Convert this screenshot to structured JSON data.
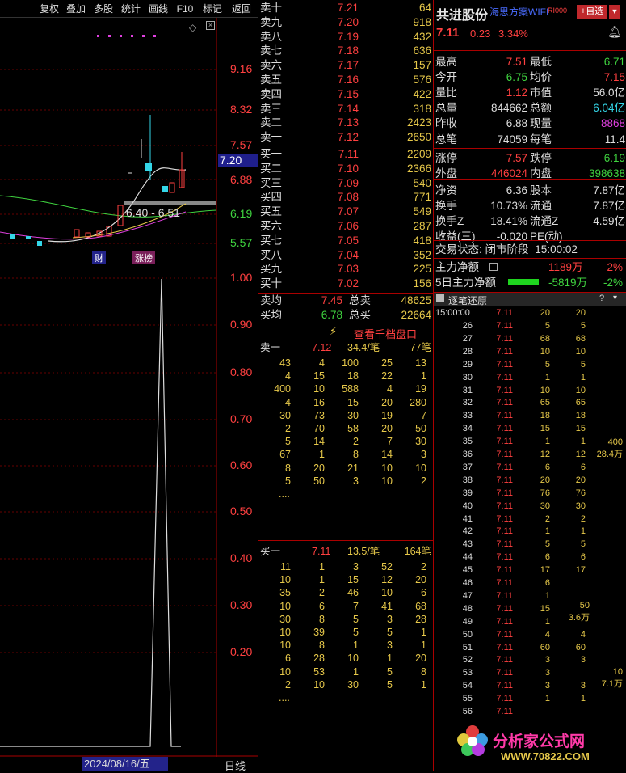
{
  "toolbar": {
    "items": [
      "复权",
      "叠加",
      "多股",
      "统计",
      "画线",
      "F10",
      "标记",
      "返回"
    ]
  },
  "kline": {
    "price_ticks": [
      "9.16",
      "8.32",
      "7.57",
      "6.88",
      "6.19",
      "5.57"
    ],
    "current_price": "7.20",
    "range_label": "6.40 - 6.51",
    "markers": [
      "财",
      "涨榜"
    ]
  },
  "volume": {
    "ticks": [
      "1.00",
      "0.90",
      "0.80",
      "0.70",
      "0.60",
      "0.50",
      "0.40",
      "0.30",
      "0.20"
    ],
    "date": "2024/08/16/五",
    "period": "日线"
  },
  "sells": [
    {
      "name": "卖十",
      "price": "7.21",
      "vol": "64"
    },
    {
      "name": "卖九",
      "price": "7.20",
      "vol": "918"
    },
    {
      "name": "卖八",
      "price": "7.19",
      "vol": "432"
    },
    {
      "name": "卖七",
      "price": "7.18",
      "vol": "636"
    },
    {
      "name": "卖六",
      "price": "7.17",
      "vol": "157"
    },
    {
      "name": "卖五",
      "price": "7.16",
      "vol": "576"
    },
    {
      "name": "卖四",
      "price": "7.15",
      "vol": "422"
    },
    {
      "name": "卖三",
      "price": "7.14",
      "vol": "318"
    },
    {
      "name": "卖二",
      "price": "7.13",
      "vol": "2423"
    },
    {
      "name": "卖一",
      "price": "7.12",
      "vol": "2650"
    }
  ],
  "buys": [
    {
      "name": "买一",
      "price": "7.11",
      "vol": "2209"
    },
    {
      "name": "买二",
      "price": "7.10",
      "vol": "2366"
    },
    {
      "name": "买三",
      "price": "7.09",
      "vol": "540"
    },
    {
      "name": "买四",
      "price": "7.08",
      "vol": "771"
    },
    {
      "name": "买五",
      "price": "7.07",
      "vol": "549"
    },
    {
      "name": "买六",
      "price": "7.06",
      "vol": "287"
    },
    {
      "name": "买七",
      "price": "7.05",
      "vol": "418"
    },
    {
      "name": "买八",
      "price": "7.04",
      "vol": "352"
    },
    {
      "name": "买九",
      "price": "7.03",
      "vol": "225"
    },
    {
      "name": "买十",
      "price": "7.02",
      "vol": "156"
    }
  ],
  "avg": {
    "sell_label": "卖均",
    "sell_price": "7.45",
    "sell_total_label": "总卖",
    "sell_total": "48625",
    "buy_label": "买均",
    "buy_price": "6.78",
    "buy_total_label": "总买",
    "buy_total": "22664"
  },
  "queue_link": "查看千档盘口",
  "sell_queue": {
    "label": "卖一",
    "price": "7.12",
    "avg": "34.4/笔",
    "count": "77笔",
    "rows": [
      [
        "43",
        "4",
        "100",
        "25",
        "13"
      ],
      [
        "4",
        "15",
        "18",
        "22",
        "1"
      ],
      [
        "400",
        "10",
        "588",
        "4",
        "19"
      ],
      [
        "4",
        "16",
        "15",
        "20",
        "280"
      ],
      [
        "30",
        "73",
        "30",
        "19",
        "7"
      ],
      [
        "2",
        "70",
        "58",
        "20",
        "50"
      ],
      [
        "5",
        "14",
        "2",
        "7",
        "30"
      ],
      [
        "67",
        "1",
        "8",
        "14",
        "3"
      ],
      [
        "8",
        "20",
        "21",
        "10",
        "10"
      ],
      [
        "5",
        "50",
        "3",
        "10",
        "2"
      ]
    ],
    "more": "...."
  },
  "buy_queue": {
    "label": "买一",
    "price": "7.11",
    "avg": "13.5/笔",
    "count": "164笔",
    "rows": [
      [
        "11",
        "1",
        "3",
        "52",
        "2"
      ],
      [
        "10",
        "1",
        "15",
        "12",
        "20"
      ],
      [
        "35",
        "2",
        "46",
        "10",
        "6"
      ],
      [
        "10",
        "6",
        "7",
        "41",
        "68"
      ],
      [
        "30",
        "8",
        "5",
        "3",
        "28"
      ],
      [
        "10",
        "39",
        "5",
        "5",
        "1"
      ],
      [
        "10",
        "8",
        "1",
        "3",
        "1"
      ],
      [
        "6",
        "28",
        "10",
        "1",
        "20"
      ],
      [
        "10",
        "53",
        "1",
        "5",
        "8"
      ],
      [
        "2",
        "10",
        "30",
        "5",
        "1"
      ]
    ],
    "more": "...."
  },
  "stock": {
    "name": "共进股份",
    "tags": "海思方案WIFI",
    "tag2": "RI000",
    "add_button": "+自选",
    "price": "7.11",
    "change": "0.23",
    "pct": "3.34%"
  },
  "stats": [
    [
      {
        "l": "最高",
        "v": "7.51",
        "c": "red"
      },
      {
        "l": "最低",
        "v": "6.71",
        "c": "grn"
      }
    ],
    [
      {
        "l": "今开",
        "v": "6.75",
        "c": "grn"
      },
      {
        "l": "均价",
        "v": "7.15",
        "c": "red"
      }
    ],
    [
      {
        "l": "量比",
        "v": "1.12",
        "c": "red"
      },
      {
        "l": "市值",
        "v": "56.0亿",
        "c": "wht"
      }
    ],
    [
      {
        "l": "总量",
        "v": "844662",
        "c": "wht"
      },
      {
        "l": "总额",
        "v": "6.04亿",
        "c": "cyn"
      }
    ],
    [
      {
        "l": "昨收",
        "v": "6.88",
        "c": "wht"
      },
      {
        "l": "现量",
        "v": "8868",
        "c": "mag"
      }
    ],
    [
      {
        "l": "总笔",
        "v": "74059",
        "c": "wht"
      },
      {
        "l": "每笔",
        "v": "11.4",
        "c": "wht"
      }
    ],
    [
      {
        "l": "涨停",
        "v": "7.57",
        "c": "red"
      },
      {
        "l": "跌停",
        "v": "6.19",
        "c": "grn"
      }
    ],
    [
      {
        "l": "外盘",
        "v": "446024",
        "c": "red"
      },
      {
        "l": "内盘",
        "v": "398638",
        "c": "grn"
      }
    ],
    [
      {
        "l": "净资",
        "v": "6.36",
        "c": "wht"
      },
      {
        "l": "股本",
        "v": "7.87亿",
        "c": "wht"
      }
    ],
    [
      {
        "l": "换手",
        "v": "10.73%",
        "c": "wht"
      },
      {
        "l": "流通",
        "v": "7.87亿",
        "c": "wht"
      }
    ],
    [
      {
        "l": "换手Z",
        "v": "18.41%",
        "c": "wht"
      },
      {
        "l": "流通Z",
        "v": "4.59亿",
        "c": "wht"
      }
    ],
    [
      {
        "l": "收益(三)",
        "v": "-0.020",
        "c": "wht"
      },
      {
        "l": "PE(动)",
        "v": "",
        "c": "wht"
      }
    ]
  ],
  "status": {
    "label": "交易状态:",
    "state": "闭市阶段",
    "time": "15:00:02"
  },
  "flow": [
    {
      "label": "主力净额",
      "value": "1189万",
      "pct": "2%",
      "color": "red"
    },
    {
      "label": "5日主力净额",
      "value": "-5819万",
      "pct": "-2%",
      "color": "grn"
    }
  ],
  "ticks_title": "逐笔还原",
  "ticks_head": {
    "time": "15:00:00",
    "price": "7.11",
    "a": "20",
    "b": "20"
  },
  "ticks": [
    [
      "26",
      "7.11",
      "5",
      "5"
    ],
    [
      "27",
      "7.11",
      "68",
      "68"
    ],
    [
      "28",
      "7.11",
      "10",
      "10"
    ],
    [
      "29",
      "7.11",
      "5",
      "5"
    ],
    [
      "30",
      "7.11",
      "1",
      "1"
    ],
    [
      "31",
      "7.11",
      "10",
      "10"
    ],
    [
      "32",
      "7.11",
      "65",
      "65"
    ],
    [
      "33",
      "7.11",
      "18",
      "18"
    ],
    [
      "34",
      "7.11",
      "15",
      "15"
    ],
    [
      "35",
      "7.11",
      "1",
      "1"
    ],
    [
      "36",
      "7.11",
      "12",
      "12"
    ],
    [
      "37",
      "7.11",
      "6",
      "6"
    ],
    [
      "38",
      "7.11",
      "20",
      "20"
    ],
    [
      "39",
      "7.11",
      "76",
      "76"
    ],
    [
      "40",
      "7.11",
      "30",
      "30"
    ],
    [
      "41",
      "7.11",
      "2",
      "2"
    ],
    [
      "42",
      "7.11",
      "1",
      "1"
    ],
    [
      "43",
      "7.11",
      "5",
      "5"
    ],
    [
      "44",
      "7.11",
      "6",
      "6"
    ],
    [
      "45",
      "7.11",
      "17",
      "17"
    ],
    [
      "46",
      "7.11",
      "6",
      ""
    ],
    [
      "47",
      "7.11",
      "1",
      ""
    ],
    [
      "48",
      "7.11",
      "15",
      ""
    ],
    [
      "49",
      "7.11",
      "1",
      ""
    ],
    [
      "50",
      "7.11",
      "4",
      "4"
    ],
    [
      "51",
      "7.11",
      "60",
      "60"
    ],
    [
      "52",
      "7.11",
      "3",
      "3"
    ],
    [
      "53",
      "7.11",
      "3",
      ""
    ],
    [
      "54",
      "7.11",
      "3",
      "3"
    ],
    [
      "55",
      "7.11",
      "1",
      "1"
    ],
    [
      "56",
      "7.11",
      "",
      ""
    ]
  ],
  "tick_side_notes": [
    {
      "a": "400",
      "b": "28.4万"
    },
    {
      "a": "50",
      "b": "3.6万"
    },
    {
      "a": "10",
      "b": "7.1万"
    }
  ],
  "logo": {
    "text": "分析家公式网",
    "url": "WWW.70822.COM"
  }
}
